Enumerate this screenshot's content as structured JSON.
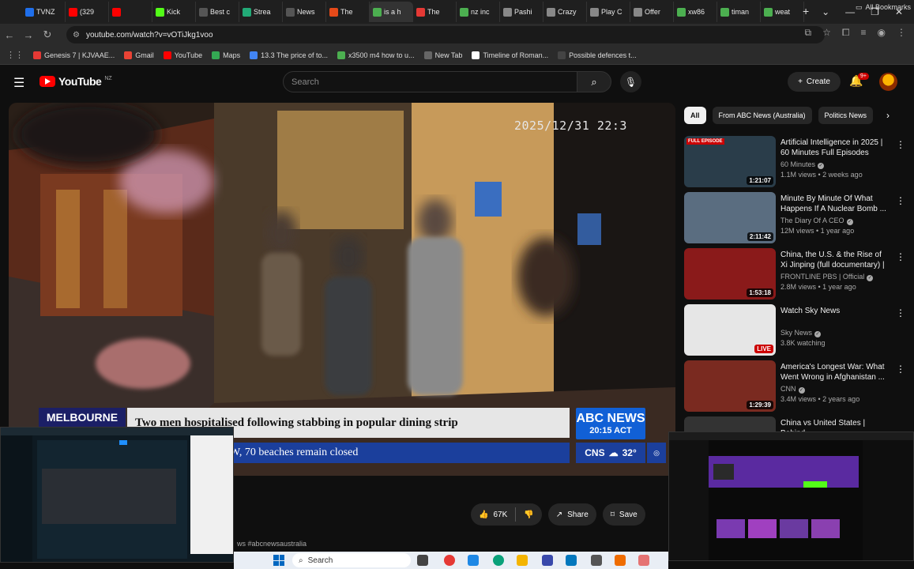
{
  "browser": {
    "tabs": [
      {
        "label": "TVNZ",
        "color": "#1f6feb"
      },
      {
        "label": "(329",
        "color": "#ff0000"
      },
      {
        "label": "",
        "color": "#ff0000"
      },
      {
        "label": "Kick",
        "color": "#53fc18"
      },
      {
        "label": "Best c",
        "color": "#555555"
      },
      {
        "label": "Strea",
        "color": "#22aa77"
      },
      {
        "label": "News",
        "color": "#555555"
      },
      {
        "label": "The",
        "color": "#e64a19"
      },
      {
        "label": "is a h",
        "color": "#4caf50"
      },
      {
        "label": "The",
        "color": "#e53935"
      },
      {
        "label": "nz inc",
        "color": "#4caf50"
      },
      {
        "label": "Pashi",
        "color": "#888888"
      },
      {
        "label": "Crazy",
        "color": "#888888"
      },
      {
        "label": "Play C",
        "color": "#888888"
      },
      {
        "label": "Offer",
        "color": "#888888"
      },
      {
        "label": "xw86",
        "color": "#4caf50"
      },
      {
        "label": "timan",
        "color": "#4caf50"
      },
      {
        "label": "weat",
        "color": "#4caf50"
      }
    ],
    "url": "youtube.com/watch?v=vOTiJkg1voo",
    "bookmarks": [
      {
        "label": "Genesis 7 | KJVAAE...",
        "color": "#e53935"
      },
      {
        "label": "Gmail",
        "color": "#ea4335"
      },
      {
        "label": "YouTube",
        "color": "#ff0000"
      },
      {
        "label": "Maps",
        "color": "#34a853"
      },
      {
        "label": "13.3 The price of to...",
        "color": "#4285f4"
      },
      {
        "label": "x3500 m4 how to u...",
        "color": "#4caf50"
      },
      {
        "label": "New Tab",
        "color": "#666666"
      },
      {
        "label": "Timeline of Roman...",
        "color": "#ffffff"
      },
      {
        "label": "Possible defences t...",
        "color": "#444444"
      }
    ],
    "all_bookmarks": "All Bookmarks"
  },
  "youtube": {
    "logo_text": "YouTube",
    "region": "NZ",
    "search_placeholder": "Search",
    "create_label": "Create",
    "notif_count": "9+"
  },
  "video": {
    "timestamp": "2025/12/31 22:3",
    "location": "MELBOURNE",
    "headline": "Two men hospitalised following stabbing in popular dining strip",
    "ticker": "W, 70 beaches remain closed",
    "network": "ABC NEWS",
    "network_time": "20:15 ACT",
    "weather_city": "CNS",
    "weather_temp": "32°",
    "likes": "67K",
    "share_label": "Share",
    "save_label": "Save",
    "hashtags": "ws #abcnewsaustralia"
  },
  "chips": [
    {
      "label": "All",
      "active": true
    },
    {
      "label": "From ABC News (Australia)",
      "active": false
    },
    {
      "label": "Politics News",
      "active": false
    }
  ],
  "recommendations": [
    {
      "title": "Artificial Intelligence in 2025 | 60 Minutes Full Episodes",
      "channel": "60 Minutes",
      "meta": "1.1M views • 2 weeks ago",
      "duration": "1:21:07",
      "badge": "FULL EPISODE",
      "thumb": "#2a3d4a"
    },
    {
      "title": "Minute By Minute Of What Happens If A Nuclear Bomb ...",
      "channel": "The Diary Of A CEO",
      "meta": "12M views • 1 year ago",
      "duration": "2:11:42",
      "badge": "",
      "thumb": "#5a6d80"
    },
    {
      "title": "China, the U.S. & the Rise of Xi Jinping (full documentary) | ...",
      "channel": "FRONTLINE PBS | Official",
      "meta": "2.8M views • 1 year ago",
      "duration": "1:53:18",
      "badge": "",
      "thumb": "#8a1a1a"
    },
    {
      "title": "Watch Sky News",
      "channel": "Sky News",
      "meta": "3.8K watching",
      "duration": "LIVE",
      "badge": "",
      "thumb": "#e6e6e6"
    },
    {
      "title": "America's Longest War: What Went Wrong in Afghanistan ...",
      "channel": "CNN",
      "meta": "3.4M views • 2 years ago",
      "duration": "1:29:39",
      "badge": "",
      "thumb": "#7a2a20"
    },
    {
      "title": "China vs United States | Behind",
      "channel": "",
      "meta": "",
      "duration": "",
      "badge": "",
      "thumb": "#333333"
    }
  ],
  "taskbar": {
    "search_label": "Search"
  }
}
